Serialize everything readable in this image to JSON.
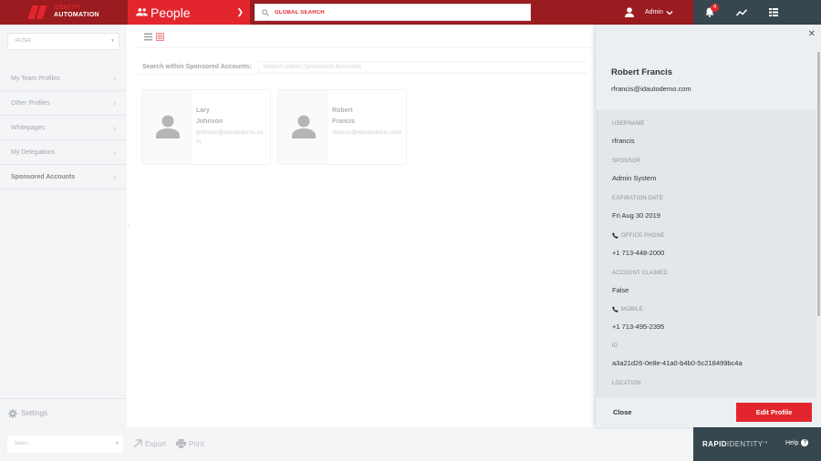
{
  "header": {
    "brand": {
      "line1": "IDENTITY",
      "line2": "AUTOMATION"
    },
    "module": {
      "title": "People",
      "icon": "people-icon"
    },
    "global_search": {
      "placeholder": "GLOBAL SEARCH"
    },
    "user": {
      "name": "Admin"
    },
    "notifications": {
      "count": "4"
    },
    "colors": {
      "primary": "#e3262d",
      "primary_dark": "#9b1c20",
      "dark": "#37474f"
    }
  },
  "sidebar": {
    "filter_placeholder": "FILTER",
    "items": [
      {
        "label": "My Team Profiles",
        "active": false
      },
      {
        "label": "Other Profiles",
        "active": false
      },
      {
        "label": "Whitepages",
        "active": false
      },
      {
        "label": "My Delegations",
        "active": false
      },
      {
        "label": "Sponsored Accounts",
        "active": true
      }
    ],
    "settings_label": "Settings"
  },
  "main": {
    "search_label": "Search within Sponsored Accounts:",
    "search_placeholder": "Search within Sponsored Accounts",
    "cards": [
      {
        "first": "Lary",
        "last": "Johnson",
        "email": "ljohnson@idautodemo.com"
      },
      {
        "first": "Robert",
        "last": "Francis",
        "email": "rfrancis@idautodemo.com"
      }
    ]
  },
  "bottom": {
    "select_placeholder": "Select...",
    "export_label": "Export",
    "print_label": "Print",
    "brand_bold": "RAPID",
    "brand_light": "IDENTITY",
    "brand_tm": "TM",
    "help_label": "Help"
  },
  "panel": {
    "name": "Robert Francis",
    "email": "rfrancis@idautodemo.com",
    "fields": [
      {
        "label": "USERNAME",
        "value": "rfrancis",
        "icon": null
      },
      {
        "label": "SPONSOR",
        "value": "Admin System",
        "icon": null
      },
      {
        "label": "EXPIRATION DATE",
        "value": "Fri Aug 30 2019",
        "icon": null
      },
      {
        "label": "OFFICE PHONE",
        "value": "+1 713-448-2000",
        "icon": "phone-icon"
      },
      {
        "label": "ACCOUNT CLAIMED",
        "value": "False",
        "icon": null
      },
      {
        "label": "MOBILE",
        "value": "+1 713-495-2395",
        "icon": "phone-icon"
      },
      {
        "label": "ID",
        "value": "a3a21d26-0e8e-41a0-b4b0-5c218499bc4a",
        "icon": null
      },
      {
        "label": "LOCATION",
        "value": "",
        "icon": null
      }
    ],
    "close_label": "Close",
    "edit_label": "Edit Profile"
  }
}
